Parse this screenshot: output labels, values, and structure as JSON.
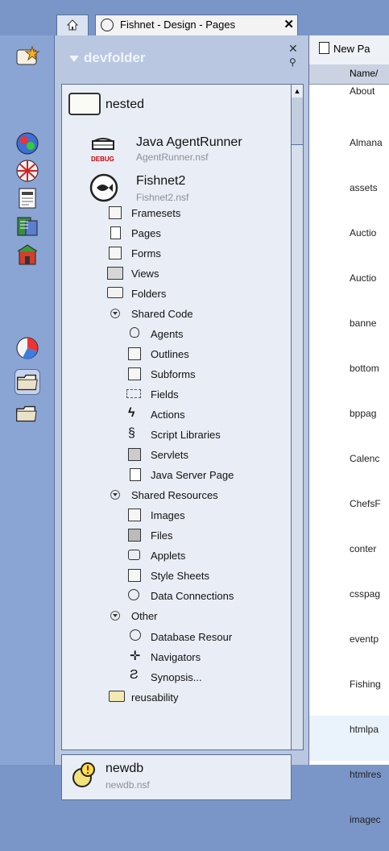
{
  "tab": {
    "title": "Fishnet - Design - Pages",
    "close": "✕"
  },
  "panel": {
    "title": "devfolder",
    "close": "✕",
    "pin": "⚲",
    "nested": "nested",
    "java_agent": {
      "title": "Java AgentRunner",
      "subtitle": "AgentRunner.nsf",
      "badge": "DEBUG"
    },
    "fishnet": {
      "title": "Fishnet2",
      "subtitle": "Fishnet2.nsf"
    },
    "items": {
      "framesets": "Framesets",
      "pages": "Pages",
      "forms": "Forms",
      "views": "Views",
      "folders": "Folders",
      "shared_code": "Shared Code",
      "agents": "Agents",
      "outlines": "Outlines",
      "subforms": "Subforms",
      "fields": "Fields",
      "actions": "Actions",
      "script_libraries": "Script Libraries",
      "servlets": "Servlets",
      "jsp": "Java Server Page",
      "shared_resources": "Shared Resources",
      "images": "Images",
      "files": "Files",
      "applets": "Applets",
      "style_sheets": "Style Sheets",
      "data_connections": "Data Connections",
      "other": "Other",
      "database_resources": "Database Resour",
      "navigators": "Navigators",
      "synopsis": "Synopsis...",
      "reusability": "reusability"
    },
    "newdb": {
      "title": "newdb",
      "subtitle": "newdb.nsf"
    }
  },
  "view": {
    "new_page": "New Pa",
    "column_name": "Name/",
    "rows": [
      "About",
      "Almana",
      "assets",
      "Auctio",
      "Auctio",
      "banne",
      "bottom",
      "bppag",
      "Calenc",
      "ChefsF",
      "conter",
      "csspag",
      "eventp",
      "Fishing",
      "htmlpa",
      "htmlres",
      "imagec"
    ]
  },
  "colors": {
    "frame": "#7a96c8",
    "panel": "#b9c7e1",
    "tree_bg": "#e9eef6",
    "row_alt": "#eaf2fb"
  }
}
